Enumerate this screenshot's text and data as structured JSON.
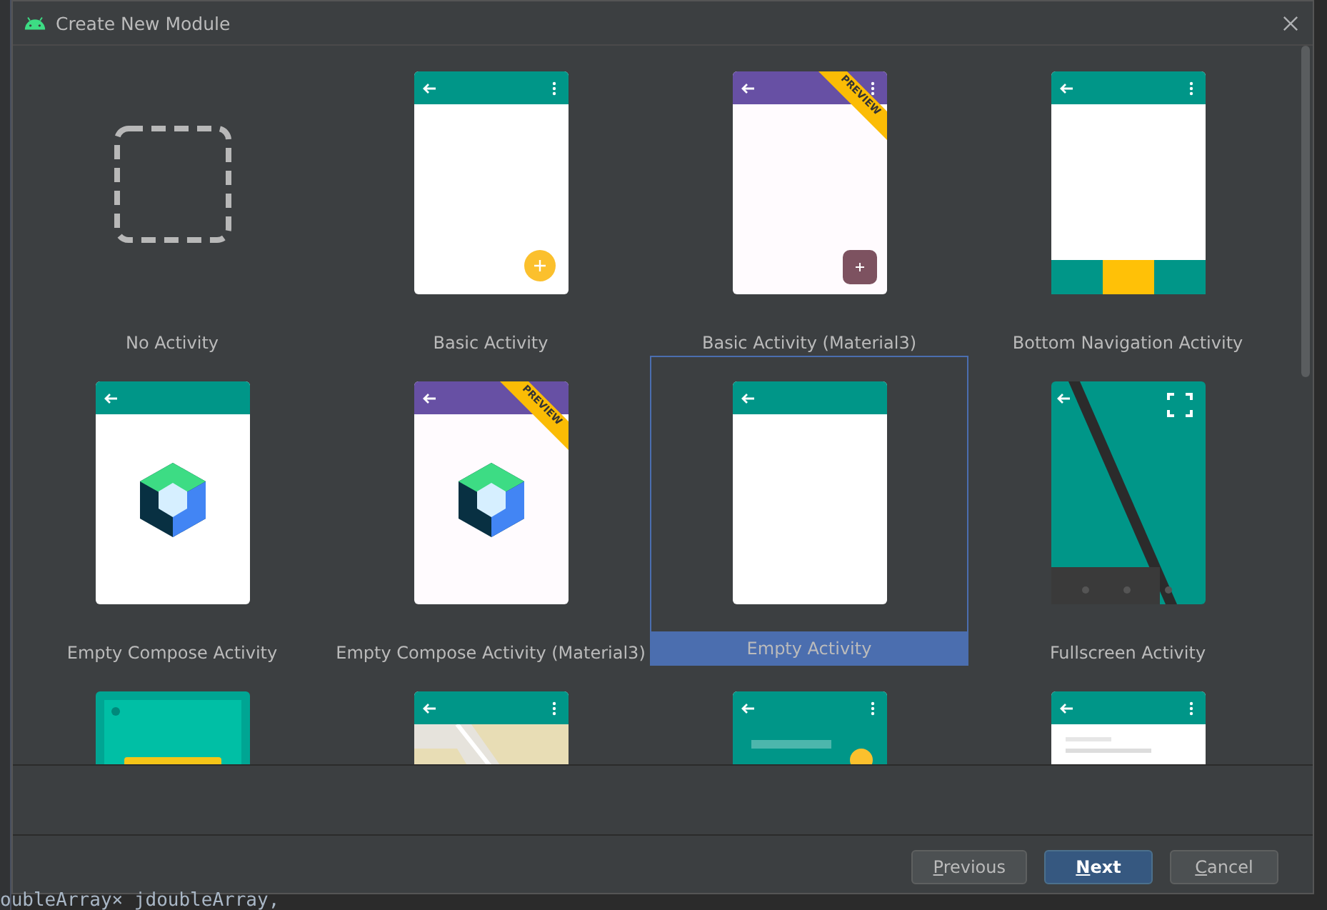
{
  "window": {
    "title": "Create New Module"
  },
  "templates": [
    {
      "label": "No Activity",
      "kind": "none",
      "selected": false
    },
    {
      "label": "Basic Activity",
      "kind": "basic",
      "selected": false
    },
    {
      "label": "Basic Activity (Material3)",
      "kind": "basic_m3",
      "selected": false,
      "ribbon": "PREVIEW"
    },
    {
      "label": "Bottom Navigation Activity",
      "kind": "bottom_nav",
      "selected": false
    },
    {
      "label": "Empty Compose Activity",
      "kind": "compose",
      "selected": false
    },
    {
      "label": "Empty Compose Activity (Material3)",
      "kind": "compose_m3",
      "selected": false,
      "ribbon": "PREVIEW"
    },
    {
      "label": "Empty Activity",
      "kind": "empty",
      "selected": true
    },
    {
      "label": "Fullscreen Activity",
      "kind": "fullscreen",
      "selected": false
    },
    {
      "kind": "tablet",
      "selected": false
    },
    {
      "kind": "map",
      "selected": false
    },
    {
      "kind": "scrolling",
      "selected": false
    },
    {
      "kind": "settings",
      "selected": false
    }
  ],
  "buttons": [
    {
      "label": "Previous",
      "kind": "secondary"
    },
    {
      "label": "Next",
      "kind": "primary"
    },
    {
      "label": "Cancel",
      "kind": "secondary"
    }
  ],
  "background_code": "oubleArray×  jdoubleArray,"
}
